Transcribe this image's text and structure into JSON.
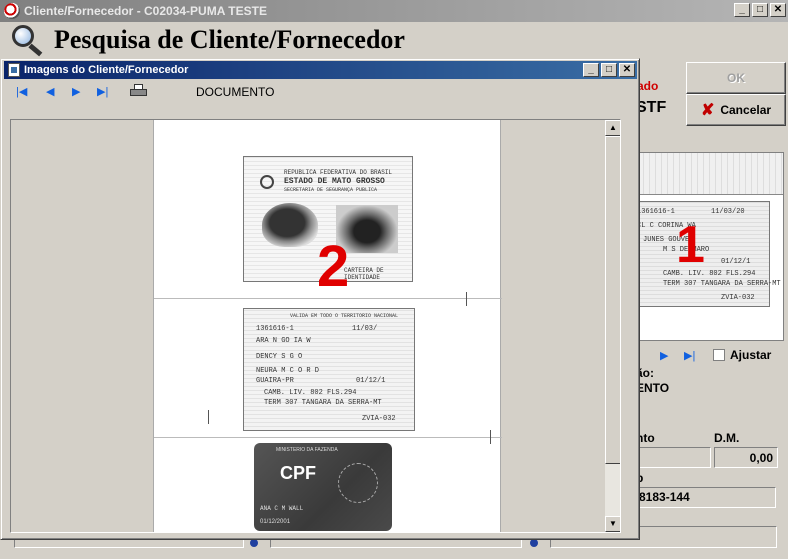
{
  "window": {
    "title": "Cliente/Fornecedor - C02034-PUMA TESTE",
    "minimize": "_",
    "maximize": "□",
    "close": "✕"
  },
  "header": {
    "title": "Pesquisa de Cliente/Fornecedor"
  },
  "background": {
    "status_partial": "ado",
    "name_partial": "STF",
    "ok_label": "OK",
    "cancel_label": "Cancelar",
    "thumbnail_number": "1",
    "thumb_lines": [
      "1361616-1",
      "11/03/20",
      "CL  C  CORINA WA",
      "JUNES GOUVEA",
      "M S DE MARO",
      "01/12/1",
      "CAMB. LIV. 802 FLS.294",
      "TERM 307 TANGARA DA SERRA-MT",
      "ZVIA-032"
    ],
    "nav_next": "▶",
    "nav_last": "▶|",
    "adjust_label": "Ajustar",
    "side_label_1": "ão:",
    "side_label_2": "ENTO",
    "side_label_3": "nto",
    "dm_label": "D.M.",
    "dm_value": "0,00",
    "side_label_4": "p",
    "cep_value": "8183-144"
  },
  "images_window": {
    "title": "Imagens do Cliente/Fornecedor",
    "toolbar": {
      "first": "|◀",
      "prev": "◀",
      "next": "▶",
      "last": "▶|",
      "doc_label": "DOCUMENTO"
    },
    "page_number": "2",
    "id_card": {
      "line1": "REPUBLICA FEDERATIVA DO BRASIL",
      "line2": "ESTADO DE MATO GROSSO",
      "line3": "SECRETARIA DE SEGURANÇA PUBLICA",
      "footer": "CARTEIRA DE IDENTIDADE"
    },
    "id_back_lines": [
      "VALIDA EM TODO O TERRITORIO NACIONAL",
      "1361616-1",
      "11/03/",
      "ARA  N   GO   IA  W",
      "DENCY   S   G   O",
      "NEURA  M  C  O  R  D",
      "GUAIRA-PR",
      "01/12/1",
      "CAMB. LIV. 802 FLS.294",
      "TERM 307 TANGARA DA SERRA-MT",
      "ZVIA-032"
    ],
    "cpf_card": {
      "ministry": "MINISTERIO DA FAZENDA",
      "label": "CPF",
      "line": "ANA C       M WALL",
      "date": "01/12/2001"
    },
    "scroll_up": "▲",
    "scroll_down": "▼"
  }
}
